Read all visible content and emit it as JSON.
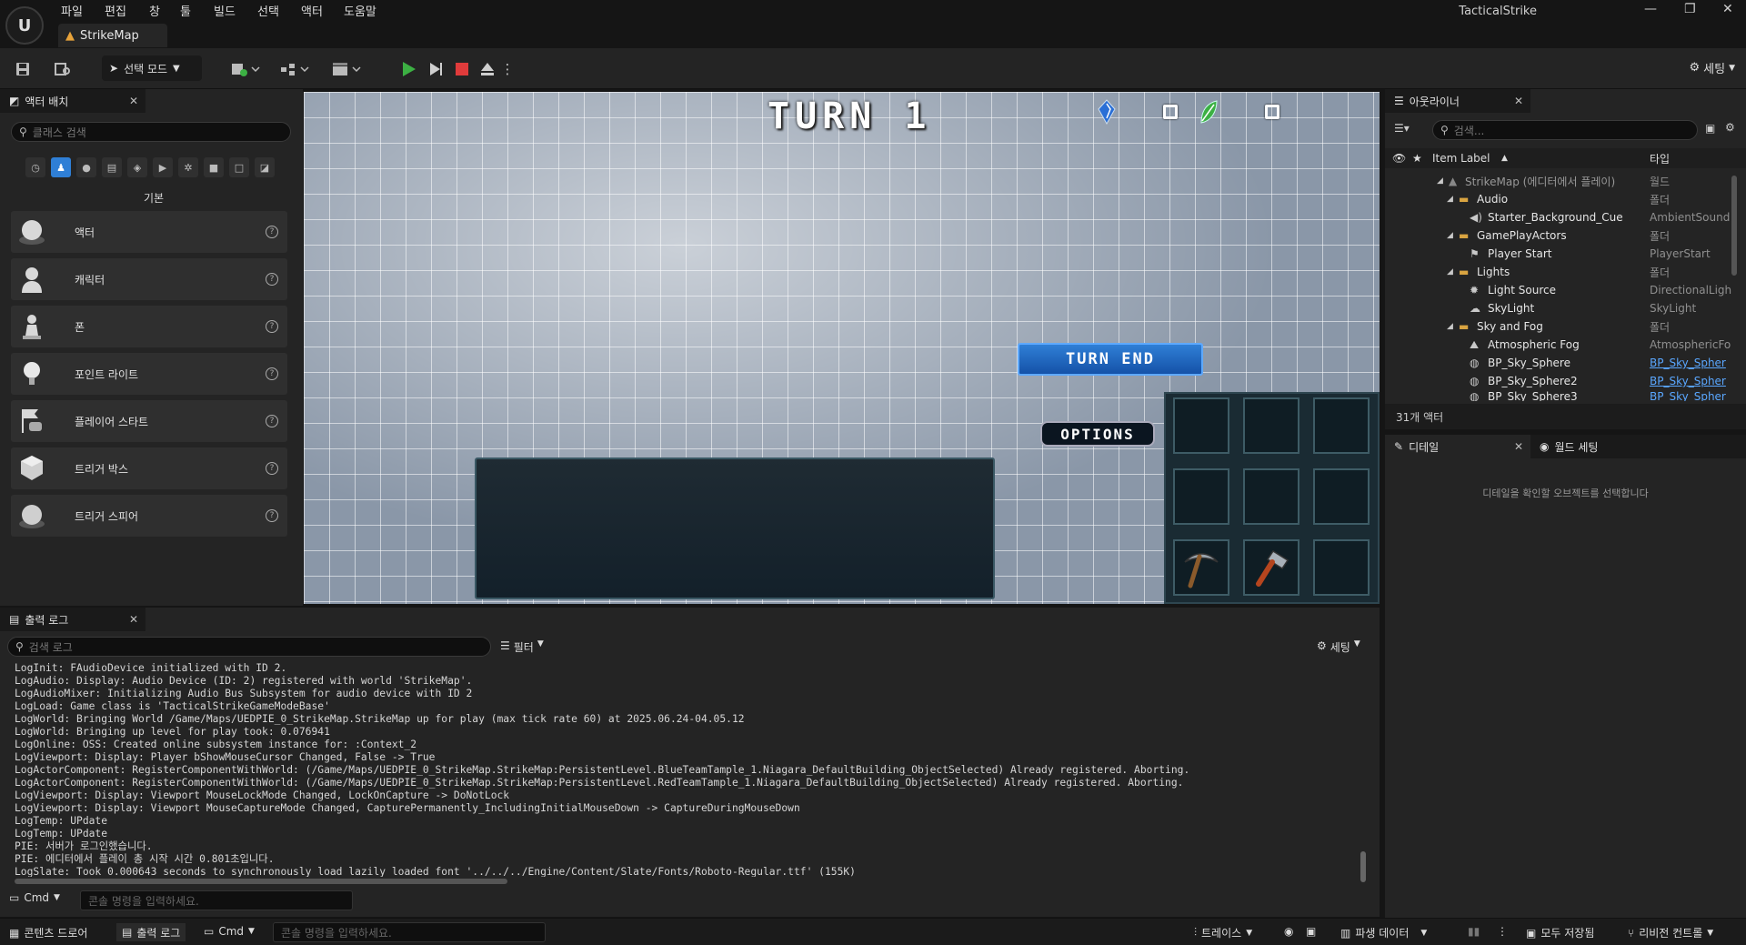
{
  "app": {
    "menus": [
      "파일",
      "편집",
      "창",
      "툴",
      "빌드",
      "선택",
      "액터",
      "도움말"
    ],
    "project_name": "TacticalStrike",
    "level_tab": "StrikeMap"
  },
  "toolbar": {
    "mode_label": "선택 모드",
    "settings_label": "세팅"
  },
  "place_actors": {
    "tab": "액터 배치",
    "search_placeholder": "클래스 검색",
    "category_title": "기본",
    "items": [
      "액터",
      "캐릭터",
      "폰",
      "포인트 라이트",
      "플레이어 스타트",
      "트리거 박스",
      "트리거 스피어"
    ]
  },
  "game_hud": {
    "turn_title": "TURN 1",
    "turn_end_label": "TURN END",
    "options_label": "OPTIONS",
    "resource_icons": [
      "blue-crystal-icon",
      "green-leaf-icon"
    ],
    "inventory_icons": [
      "pickaxe-icon",
      "hammer-icon"
    ]
  },
  "outliner": {
    "tab": "아웃라이너",
    "search_placeholder": "검색...",
    "col_label": "Item Label",
    "col_type": "타입",
    "rows": [
      {
        "name": "StrikeMap (에디터에서 플레이)",
        "type": "월드"
      },
      {
        "name": "Audio",
        "type": "폴더"
      },
      {
        "name": "Starter_Background_Cue",
        "type": "AmbientSound"
      },
      {
        "name": "GamePlayActors",
        "type": "폴더"
      },
      {
        "name": "Player Start",
        "type": "PlayerStart"
      },
      {
        "name": "Lights",
        "type": "폴더"
      },
      {
        "name": "Light Source",
        "type": "DirectionalLigh"
      },
      {
        "name": "SkyLight",
        "type": "SkyLight"
      },
      {
        "name": "Sky and Fog",
        "type": "폴더"
      },
      {
        "name": "Atmospheric Fog",
        "type": "AtmosphericFo"
      },
      {
        "name": "BP_Sky_Sphere",
        "type": "BP_Sky_Spher"
      },
      {
        "name": "BP_Sky_Sphere2",
        "type": "BP_Sky_Spher"
      },
      {
        "name": "BP_Sky_Sphere3",
        "type": "BP_Sky_Spher"
      }
    ],
    "actor_count": "31개 액터"
  },
  "details": {
    "tab": "디테일",
    "world_settings_tab": "월드 세팅",
    "empty_message": "디테일을 확인할 오브젝트를 선택합니다"
  },
  "output_log": {
    "tab": "출력 로그",
    "search_placeholder": "검색 로그",
    "filter_label": "필터",
    "settings_label": "세팅",
    "lines": [
      "LogInit: FAudioDevice initialized with ID 2.",
      "LogAudio: Display: Audio Device (ID: 2) registered with world 'StrikeMap'.",
      "LogAudioMixer: Initializing Audio Bus Subsystem for audio device with ID 2",
      "LogLoad: Game class is 'TacticalStrikeGameModeBase'",
      "LogWorld: Bringing World /Game/Maps/UEDPIE_0_StrikeMap.StrikeMap up for play (max tick rate 60) at 2025.06.24-04.05.12",
      "LogWorld: Bringing up level for play took: 0.076941",
      "LogOnline: OSS: Created online subsystem instance for: :Context_2",
      "LogViewport: Display: Player bShowMouseCursor Changed, False -> True",
      "LogActorComponent: RegisterComponentWithWorld: (/Game/Maps/UEDPIE_0_StrikeMap.StrikeMap:PersistentLevel.BlueTeamTample_1.Niagara_DefaultBuilding_ObjectSelected) Already registered. Aborting.",
      "LogActorComponent: RegisterComponentWithWorld: (/Game/Maps/UEDPIE_0_StrikeMap.StrikeMap:PersistentLevel.RedTeamTample_1.Niagara_DefaultBuilding_ObjectSelected) Already registered. Aborting.",
      "LogViewport: Display: Viewport MouseLockMode Changed, LockOnCapture -> DoNotLock",
      "LogViewport: Display: Viewport MouseCaptureMode Changed, CapturePermanently_IncludingInitialMouseDown -> CaptureDuringMouseDown",
      "LogTemp: UPdate",
      "LogTemp: UPdate",
      "PIE: 서버가 로그인했습니다.",
      "PIE: 에디터에서 플레이 총 시작 시간 0.801초입니다.",
      "LogSlate: Took 0.000643 seconds to synchronously load lazily loaded font '../../../Engine/Content/Slate/Fonts/Roboto-Regular.ttf' (155K)"
    ],
    "cmd_label": "Cmd",
    "cmd_placeholder": "콘솔 명령을 입력하세요."
  },
  "statusbar": {
    "content_drawer": "콘텐츠 드로어",
    "output_log": "출력 로그",
    "cmd_label": "Cmd",
    "cmd_placeholder": "콘솔 명령을 입력하세요.",
    "trace": "트레이스",
    "derived_data": "파생 데이터",
    "save_all": "모두 저장됨",
    "revision_control": "리비전 컨트롤"
  },
  "colors": {
    "accent_blue": "#2f7fd6",
    "play_green": "#3cb043",
    "stop_red": "#e03b3b",
    "link_blue": "#5aa7ff"
  }
}
